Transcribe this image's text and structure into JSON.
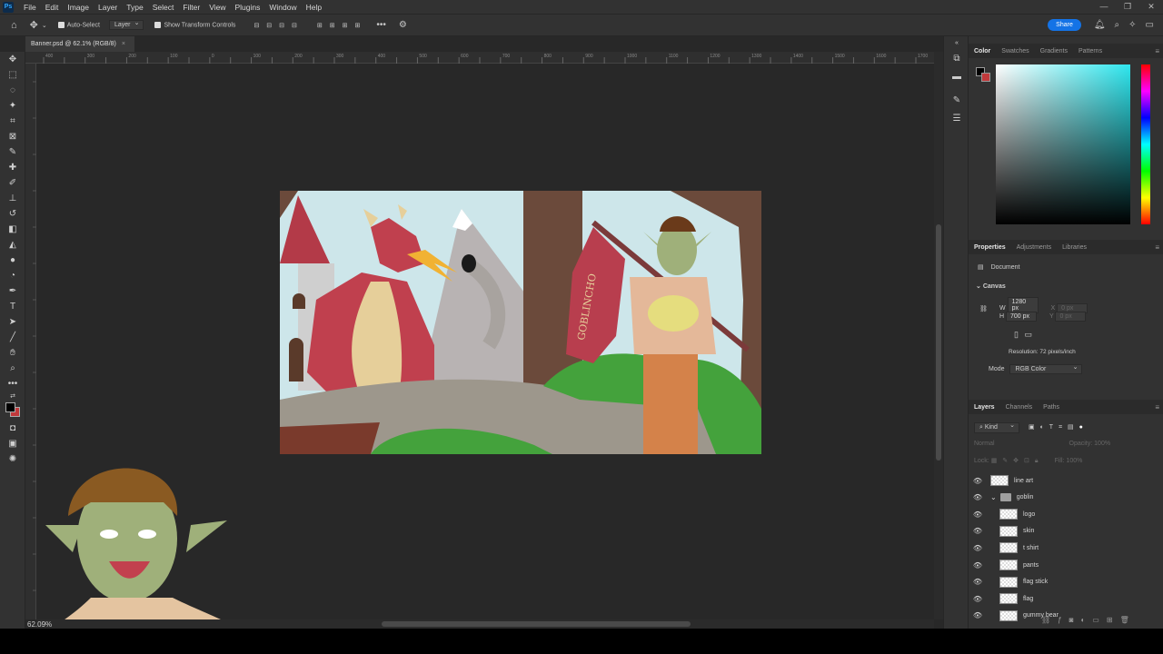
{
  "app": {
    "logo": "Ps",
    "menus": [
      "File",
      "Edit",
      "Image",
      "Layer",
      "Type",
      "Select",
      "Filter",
      "View",
      "Plugins",
      "Window",
      "Help"
    ],
    "window_controls": [
      "—",
      "❐",
      "✕"
    ]
  },
  "options_bar": {
    "auto_select_label": "Auto-Select",
    "auto_select_target": "Layer",
    "show_transform_label": "Show Transform Controls",
    "share_label": "Share"
  },
  "document": {
    "tab_title": "Banner.psd @ 62.1% (RGB/8)",
    "zoom_readout": "62.09%",
    "ruler_marks": [
      "400",
      "350",
      "300",
      "250",
      "200",
      "150",
      "100",
      "50",
      "0",
      "50",
      "100",
      "150",
      "200",
      "250",
      "300",
      "350",
      "400",
      "450",
      "500",
      "550",
      "600",
      "650",
      "700",
      "750",
      "800",
      "850",
      "900",
      "950",
      "1000",
      "1050",
      "1100",
      "1150",
      "1200",
      "1250",
      "1300",
      "1350",
      "1400",
      "1450",
      "1500",
      "1550",
      "1600",
      "1650",
      "1700"
    ]
  },
  "artwork": {
    "flag_text": "GOBLINCHO"
  },
  "color_panel": {
    "tabs": [
      "Color",
      "Swatches",
      "Gradients",
      "Patterns"
    ],
    "foreground": "#000000",
    "background": "#c0393b",
    "hue": "#2ee6ee"
  },
  "properties_panel": {
    "tabs": [
      "Properties",
      "Adjustments",
      "Libraries"
    ],
    "section": "Document",
    "canvas_label": "Canvas",
    "w_label": "W",
    "w_value": "1280 px",
    "x_label": "X",
    "x_placeholder": "0 px",
    "h_label": "H",
    "h_value": "700 px",
    "y_label": "Y",
    "y_placeholder": "0 px",
    "resolution": "Resolution: 72 pixels/inch",
    "mode_label": "Mode",
    "mode_value": "RGB Color"
  },
  "layers_panel": {
    "tabs": [
      "Layers",
      "Channels",
      "Paths"
    ],
    "filter_kind": "Kind",
    "blend_mode": "Normal",
    "opacity_label": "Opacity:",
    "opacity_value": "100%",
    "lock_label": "Lock:",
    "fill_label": "Fill:",
    "fill_value": "100%",
    "layers": [
      {
        "name": "line art",
        "indent": 0,
        "type": "layer"
      },
      {
        "name": "goblin",
        "indent": 0,
        "type": "group"
      },
      {
        "name": "logo",
        "indent": 1,
        "type": "layer"
      },
      {
        "name": "skin",
        "indent": 1,
        "type": "layer"
      },
      {
        "name": "t shirt",
        "indent": 1,
        "type": "layer"
      },
      {
        "name": "pants",
        "indent": 1,
        "type": "layer"
      },
      {
        "name": "flag stick",
        "indent": 1,
        "type": "layer"
      },
      {
        "name": "flag",
        "indent": 1,
        "type": "layer"
      },
      {
        "name": "gummy bear",
        "indent": 1,
        "type": "layer"
      }
    ]
  }
}
